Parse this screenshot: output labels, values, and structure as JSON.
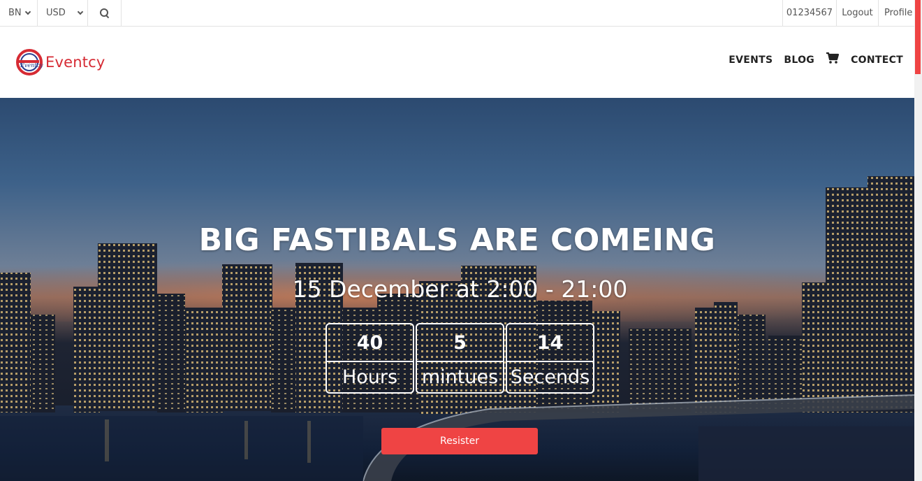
{
  "topbar": {
    "language": "BN",
    "currency": "USD",
    "phone": "01234567",
    "logout": "Logout",
    "profile": "Profile"
  },
  "brand": {
    "name": "Eventcy",
    "mark_text": "Eventcy",
    "color": "#d62b34"
  },
  "nav": {
    "events": "EVENTS",
    "blog": "BLOG",
    "cart_icon": "cart-icon",
    "contact": "CONTECT"
  },
  "hero": {
    "title": "BIG FASTIBALS ARE COMEING",
    "date": "15 December at 2:00 - 21:00",
    "countdown": [
      {
        "value": "40",
        "label": "Hours"
      },
      {
        "value": "5",
        "label": "mintues"
      },
      {
        "value": "14",
        "label": "Secends"
      }
    ],
    "register_label": "Resister"
  },
  "colors": {
    "accent": "#ef4444"
  }
}
